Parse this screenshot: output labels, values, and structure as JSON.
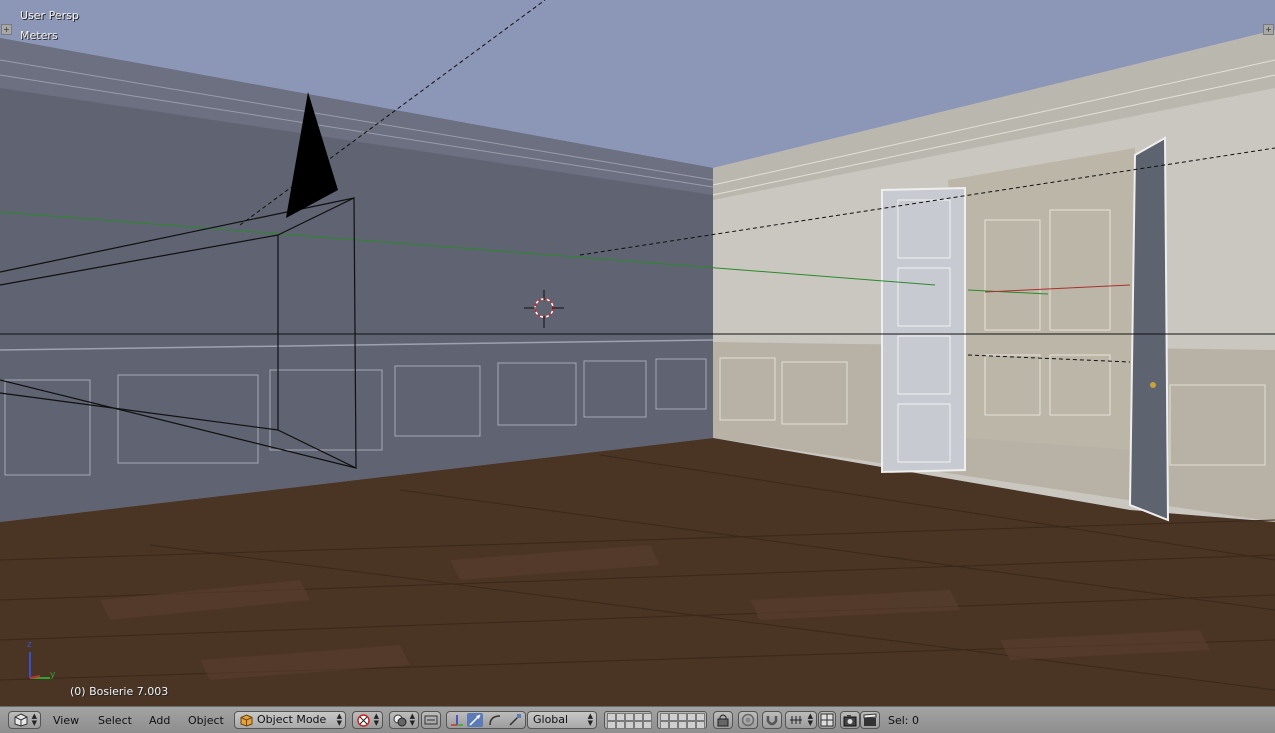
{
  "viewport": {
    "view_name": "User Persp",
    "units": "Meters",
    "object_info": "(0) Bosierie 7.003",
    "axis_labels": {
      "z": "z",
      "y": "y",
      "x": "x"
    }
  },
  "header": {
    "menus": {
      "view": "View",
      "select": "Select",
      "add": "Add",
      "object": "Object"
    },
    "mode": "Object Mode",
    "orientation": "Global",
    "sel_count": "Sel: 0",
    "icons": {
      "editor_type": "cube-icon",
      "pivot": "pivot-icon",
      "shading": "spheres-icon",
      "manipulator": "manipulator-icon",
      "translate": "translate-icon",
      "rotate": "rotate-icon",
      "scale": "scale-icon",
      "layers": "layer-grid",
      "lock": "lock-icon",
      "snap": "magnet-icon",
      "proportional": "proportional-icon",
      "render": "camera-icon",
      "film": "clapper-icon"
    }
  },
  "colors": {
    "sky": "#8c96b6",
    "wall_left": "#5f6372",
    "wall_right": "#c9c7bf",
    "floor": "#4a3424",
    "header": "#999999"
  }
}
